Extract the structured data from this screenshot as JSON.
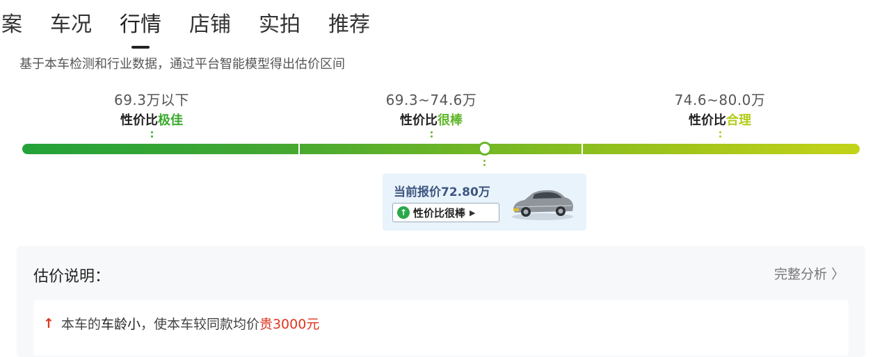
{
  "tabs": [
    "档案",
    "车况",
    "行情",
    "店铺",
    "实拍",
    "推荐"
  ],
  "active_tab": "行情",
  "subtitle": "基于本车检测和行业数据，通过平台智能模型得出估价区间",
  "ranges": [
    {
      "price": "69.3万以下",
      "prefix": "性价比",
      "rating": "极佳",
      "color": "#3aa92e"
    },
    {
      "price": "69.3~74.6万",
      "prefix": "性价比",
      "rating": "很棒",
      "color": "#5fb62a"
    },
    {
      "price": "74.6~80.0万",
      "prefix": "性价比",
      "rating": "合理",
      "color": "#a8ca1c"
    }
  ],
  "current": {
    "label": "当前报价72.80万",
    "value": 72.8,
    "badge": "性价比很棒",
    "icon": "arrow-up-circle-icon",
    "image": "car-image"
  },
  "estimate": {
    "title": "估价说明：",
    "more": "完整分析 〉",
    "reason": {
      "pre": "本车的",
      "em": "车龄小",
      "mid": "，使本车较同款均价",
      "price": "贵3000元",
      "icon": "arrow-up-icon"
    }
  },
  "colors": {
    "up": "#e0341f",
    "badge_green": "#2aa84a",
    "card_bg": "#e9f3fb"
  }
}
